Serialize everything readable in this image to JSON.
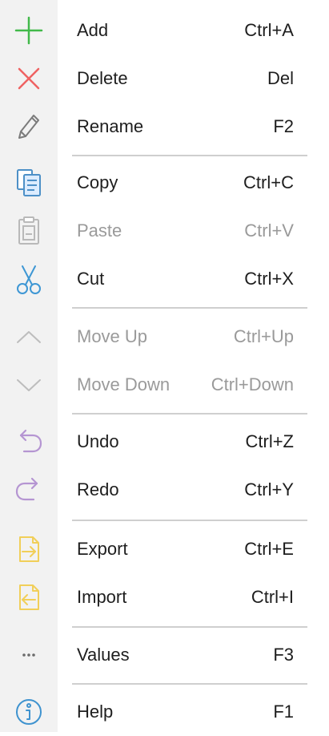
{
  "colors": {
    "add": "#41b94a",
    "delete": "#ef6262",
    "rename": "#7b7b7b",
    "copy": "#4d90c7",
    "paste": "#b9b9b9",
    "cut": "#3e97d4",
    "move": "#bdbdbd",
    "undo_redo": "#b595d2",
    "export_import": "#f1cf59",
    "values": "#6b6b6b",
    "help": "#3f93cf",
    "disabled_text": "#9a9a9a",
    "strip": "#f2f2f2"
  },
  "menu": {
    "items": [
      {
        "id": "add",
        "label": "Add",
        "shortcut": "Ctrl+A",
        "icon": "plus-icon",
        "enabled": true
      },
      {
        "id": "delete",
        "label": "Delete",
        "shortcut": "Del",
        "icon": "close-icon",
        "enabled": true
      },
      {
        "id": "rename",
        "label": "Rename",
        "shortcut": "F2",
        "icon": "pencil-icon",
        "enabled": true
      },
      {
        "id": "copy",
        "label": "Copy",
        "shortcut": "Ctrl+C",
        "icon": "copy-icon",
        "enabled": true
      },
      {
        "id": "paste",
        "label": "Paste",
        "shortcut": "Ctrl+V",
        "icon": "paste-icon",
        "enabled": false
      },
      {
        "id": "cut",
        "label": "Cut",
        "shortcut": "Ctrl+X",
        "icon": "scissors-icon",
        "enabled": true
      },
      {
        "id": "move-up",
        "label": "Move Up",
        "shortcut": "Ctrl+Up",
        "icon": "chevron-up-icon",
        "enabled": false
      },
      {
        "id": "move-down",
        "label": "Move Down",
        "shortcut": "Ctrl+Down",
        "icon": "chevron-down-icon",
        "enabled": false
      },
      {
        "id": "undo",
        "label": "Undo",
        "shortcut": "Ctrl+Z",
        "icon": "undo-icon",
        "enabled": true
      },
      {
        "id": "redo",
        "label": "Redo",
        "shortcut": "Ctrl+Y",
        "icon": "redo-icon",
        "enabled": true
      },
      {
        "id": "export",
        "label": "Export",
        "shortcut": "Ctrl+E",
        "icon": "export-icon",
        "enabled": true
      },
      {
        "id": "import",
        "label": "Import",
        "shortcut": "Ctrl+I",
        "icon": "import-icon",
        "enabled": true
      },
      {
        "id": "values",
        "label": "Values",
        "shortcut": "F3",
        "icon": "ellipsis-icon",
        "enabled": true
      },
      {
        "id": "help",
        "label": "Help",
        "shortcut": "F1",
        "icon": "info-icon",
        "enabled": true
      }
    ]
  }
}
